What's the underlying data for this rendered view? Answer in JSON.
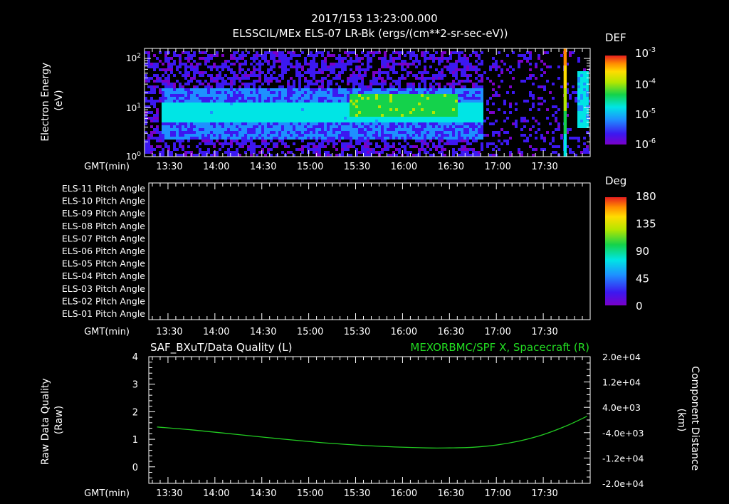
{
  "header": {
    "timestamp": "2017/153 13:23:00.000",
    "title": "ELSSCIL/MEx ELS-07 LR-Bk  (ergs/(cm**2-sr-sec-eV))"
  },
  "time_axis": {
    "label": "GMT(min)",
    "ticks": [
      "13:30",
      "14:00",
      "14:30",
      "15:00",
      "15:30",
      "16:00",
      "16:30",
      "17:00",
      "17:30"
    ]
  },
  "colors": {
    "background": "#000000",
    "axes": "#ffffff",
    "line": "#22cc22",
    "right_title": "#22dd22",
    "colormap": [
      "#7a00c8",
      "#3c18f0",
      "#1e90ff",
      "#00e5e5",
      "#14d24b",
      "#b4e600",
      "#ffdc00",
      "#ff8c00",
      "#e61e1e"
    ]
  },
  "chart_data": [
    {
      "type": "heatmap",
      "ylabel": "Electron Energy\n(eV)",
      "ylog": true,
      "ylim": [
        1,
        160
      ],
      "y_ticks": [
        "10^0",
        "10^1",
        "10^2"
      ],
      "xlim_minutes": [
        13.25,
        18.0
      ],
      "colorbar": {
        "title": "DEF",
        "ticks": [
          "10^-3",
          "10^-4",
          "10^-5",
          "10^-6"
        ],
        "range": [
          1e-06,
          0.001
        ],
        "log": true
      },
      "bands": [
        {
          "t_start": "13:25",
          "t_end": "16:50",
          "energy_low": 2.5,
          "energy_high": 25,
          "core_low": 5,
          "core_high": 13,
          "level": "1e-5"
        },
        {
          "t_start": "15:25",
          "t_end": "16:35",
          "energy_low": 7,
          "energy_high": 20,
          "level": "3e-5"
        },
        {
          "t_start": "17:43",
          "t_end": "17:45",
          "energy_low": 1,
          "energy_high": 150,
          "level": "1e-4"
        },
        {
          "t_start": "17:51",
          "t_end": "17:58",
          "energy_low": 4,
          "energy_high": 60,
          "level": "1e-5"
        }
      ],
      "background_noise": {
        "energy_low": 1,
        "energy_high": 160,
        "level": "1e-6"
      }
    },
    {
      "type": "heatmap",
      "rows": [
        "ELS-11 Pitch Angle",
        "ELS-10 Pitch Angle",
        "ELS-09 Pitch Angle",
        "ELS-08 Pitch Angle",
        "ELS-07 Pitch Angle",
        "ELS-06 Pitch Angle",
        "ELS-05 Pitch Angle",
        "ELS-04 Pitch Angle",
        "ELS-03 Pitch Angle",
        "ELS-02 Pitch Angle",
        "ELS-01 Pitch Angle"
      ],
      "values": [],
      "colorbar": {
        "title": "Deg",
        "ticks": [
          "180",
          "135",
          "90",
          "45",
          "0"
        ],
        "range": [
          0,
          180
        ]
      }
    },
    {
      "type": "line",
      "title_left": "SAF_BXuT/Data Quality (L)",
      "title_right": "MEXORBMC/SPF X, Spacecraft (R)",
      "ylabel_left": "Raw Data Quality\n(Raw)",
      "ylabel_right": "Component Distance\n(km)",
      "ylim_left": [
        -0.6,
        4
      ],
      "left_ticks": [
        "0",
        "1",
        "2",
        "3",
        "4"
      ],
      "ylim_right": [
        -20000,
        20000
      ],
      "right_ticks": [
        "2.0e+04",
        "1.2e+04",
        "4.0e+03",
        "-4.0e+03",
        "-1.2e+04",
        "-2.0e+04"
      ],
      "series": [
        {
          "name": "MEXORBMC/SPF X, Spacecraft (R)",
          "x": [
            "13:23",
            "13:45",
            "14:15",
            "14:45",
            "15:15",
            "15:45",
            "16:15",
            "16:30",
            "16:45",
            "17:00",
            "17:15",
            "17:30",
            "17:45",
            "17:58"
          ],
          "values": [
            -2200,
            -3100,
            -4600,
            -6100,
            -7400,
            -8300,
            -8800,
            -8800,
            -8600,
            -7900,
            -6600,
            -4600,
            -1800,
            1200
          ]
        }
      ]
    }
  ]
}
